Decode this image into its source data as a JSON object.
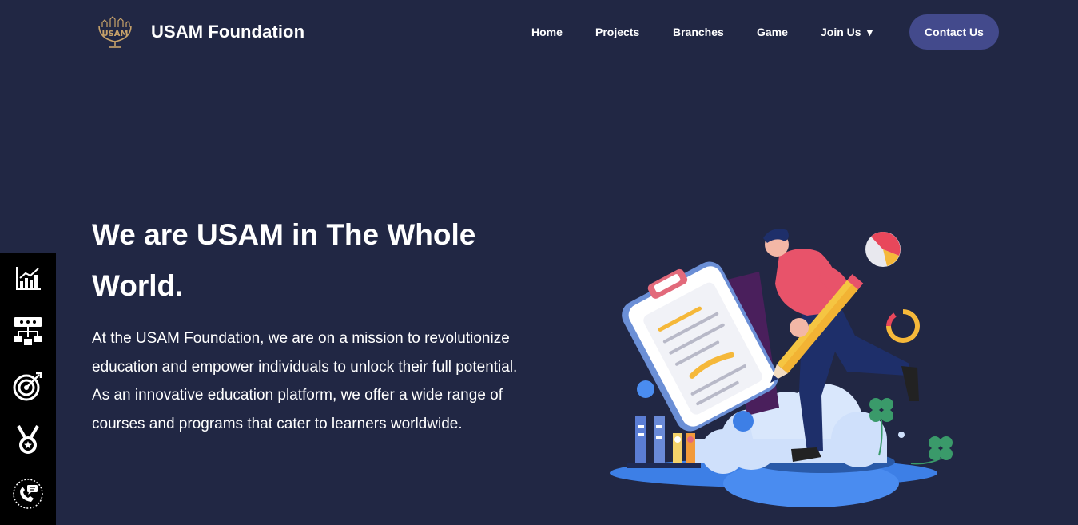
{
  "brand": {
    "name": "USAM Foundation",
    "logo_text": "USAM",
    "logo_icon": "usam-logo"
  },
  "nav": {
    "items": [
      {
        "label": "Home"
      },
      {
        "label": "Projects"
      },
      {
        "label": "Branches"
      },
      {
        "label": "Game"
      },
      {
        "label": "Join Us ▼"
      }
    ],
    "contact_label": "Contact Us"
  },
  "hero": {
    "title": "We are USAM in The Whole World.",
    "description": "At the USAM Foundation, we are on a mission to revolutionize education and empower individuals to unlock their full potential. As an innovative education platform, we offer a wide range of courses and programs that cater to learners worldwide."
  },
  "sidebar": {
    "icons": [
      "bar-chart-icon",
      "org-chart-icon",
      "target-icon",
      "medal-icon",
      "phone-chat-icon"
    ]
  },
  "colors": {
    "background": "#212744",
    "accent": "#434a8c",
    "sidebar": "#000000"
  }
}
